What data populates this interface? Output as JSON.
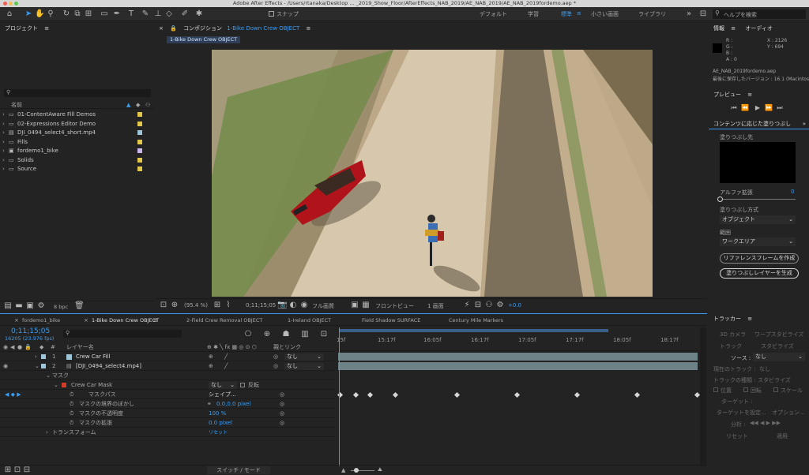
{
  "window": {
    "title": "Adobe After Effects - /Users/rtanaka/Desktop ... _2019_Show_Floor/AfterEffects_NAB_2019/AE_NAB_2019/AE_NAB_2019fordemo.aep *"
  },
  "toolbar": {
    "snap_label": "スナップ",
    "workspaces": [
      "デフォルト",
      "学習",
      "標準",
      "小さい画面",
      "ライブラリ"
    ],
    "active_workspace": "標準",
    "help_placeholder": "ヘルプを検索"
  },
  "project": {
    "title": "プロジェクト",
    "name_header": "名前",
    "items": [
      {
        "name": "01-ContentAware Fill Demos",
        "type": "folder",
        "color": "#e2c84a"
      },
      {
        "name": "02-Expressions Editor Demo",
        "type": "folder",
        "color": "#e2c84a"
      },
      {
        "name": "DJI_0494_select4_short.mp4",
        "type": "footage",
        "color": "#9ec4d8"
      },
      {
        "name": "Fills",
        "type": "folder",
        "color": "#e2c84a"
      },
      {
        "name": "fordemo1_bike",
        "type": "comp",
        "color": "#c8b7e8"
      },
      {
        "name": "Solids",
        "type": "folder",
        "color": "#e2c84a"
      },
      {
        "name": "Source",
        "type": "folder",
        "color": "#e2c84a"
      }
    ],
    "bpc": "8 bpc"
  },
  "composition": {
    "header": "コンポジション",
    "comp_name": "1-Bike Down Crew OBJECT",
    "tab": "1-Bike Down Crew OBJECT",
    "zoom": "(95.4 %)",
    "timecode": "0;11;15;05",
    "resolution": "フル画質",
    "view": "フロントビュー",
    "views_count": "1 画面",
    "exposure": "+0.0"
  },
  "info": {
    "title": "情報",
    "audio_tab": "オーディオ",
    "r": "R :",
    "g": "G :",
    "b": "B :",
    "a": "A : 0",
    "x": "X : 2126",
    "y": "Y : 694",
    "file": "AE_NAB_2019fordemo.aep",
    "saved": "最後に保存したバージョン : 16.1 (Macintosh)"
  },
  "preview": {
    "title": "プレビュー"
  },
  "caf": {
    "title": "コンテンツに応じた塗りつぶし",
    "fill_target": "塗りつぶし先",
    "alpha_label": "アルファ拡張",
    "alpha_value": "0",
    "method_label": "塗りつぶし方式",
    "method_value": "オブジェクト",
    "range_label": "範囲",
    "range_value": "ワークエリア",
    "ref_button": "リファレンスフレームを作成",
    "gen_button": "塗りつぶしレイヤーを生成"
  },
  "timeline": {
    "tabs": [
      "fordemo1_bike",
      "1-Bike Down Crew OBJECT",
      "2-Field Crew Removal OBJECT",
      "1-Ireland OBJECT",
      "Field Shadow SURFACE",
      "Century Mile Markers"
    ],
    "active_tab": "1-Bike Down Crew OBJECT",
    "timecode": "0;11;15;05",
    "frames": "16205 (23.976 fps)",
    "col_layer": "レイヤー名",
    "col_parent": "親とリンク",
    "layers": [
      {
        "num": "1",
        "name": "Crew Car Fill",
        "parent": "なし",
        "color": "#9ec4d8"
      },
      {
        "num": "2",
        "name": "[DJI_0494_select4.mp4]",
        "parent": "なし",
        "color": "#9ec4d8"
      }
    ],
    "mask_group": "マスク",
    "mask_name": "Crew Car Mask",
    "mask_mode": "なし",
    "mask_invert": "反転",
    "mask_path": "マスクパス",
    "mask_path_value": "シェイプ...",
    "mask_feather": "マスクの境界のぼかし",
    "mask_feather_value": "0.0,0.0 pixel",
    "mask_opacity": "マスクの不透明度",
    "mask_opacity_value": "100 %",
    "mask_expansion": "マスクの拡張",
    "mask_expansion_value": "0.0 pixel",
    "transform": "トランスフォーム",
    "transform_reset": "リセット",
    "switch_mode": "スイッチ / モード",
    "ruler": [
      "15f",
      "15:17f",
      "16:05f",
      "16:17f",
      "17:05f",
      "17:17f",
      "18:05f",
      "18:17f"
    ]
  },
  "tracker": {
    "title": "トラッカー",
    "btn_3d": "3D カメラ",
    "btn_warp": "ワープスタビライズ",
    "btn_track": "トラック",
    "btn_stab": "スタビライズ",
    "source_label": "ソース :",
    "source_value": "なし",
    "current_track": "現在のトラック :",
    "current_value": "なし",
    "track_type": "トラックの種類 :",
    "track_type_value": "スタビライズ",
    "pos": "位置",
    "rot": "回転",
    "scale": "スケール",
    "target": "ターゲット :",
    "set_target": "ターゲットを設定...",
    "options": "オプション...",
    "analyze": "分析 :",
    "reset": "リセット",
    "apply": "適用"
  }
}
